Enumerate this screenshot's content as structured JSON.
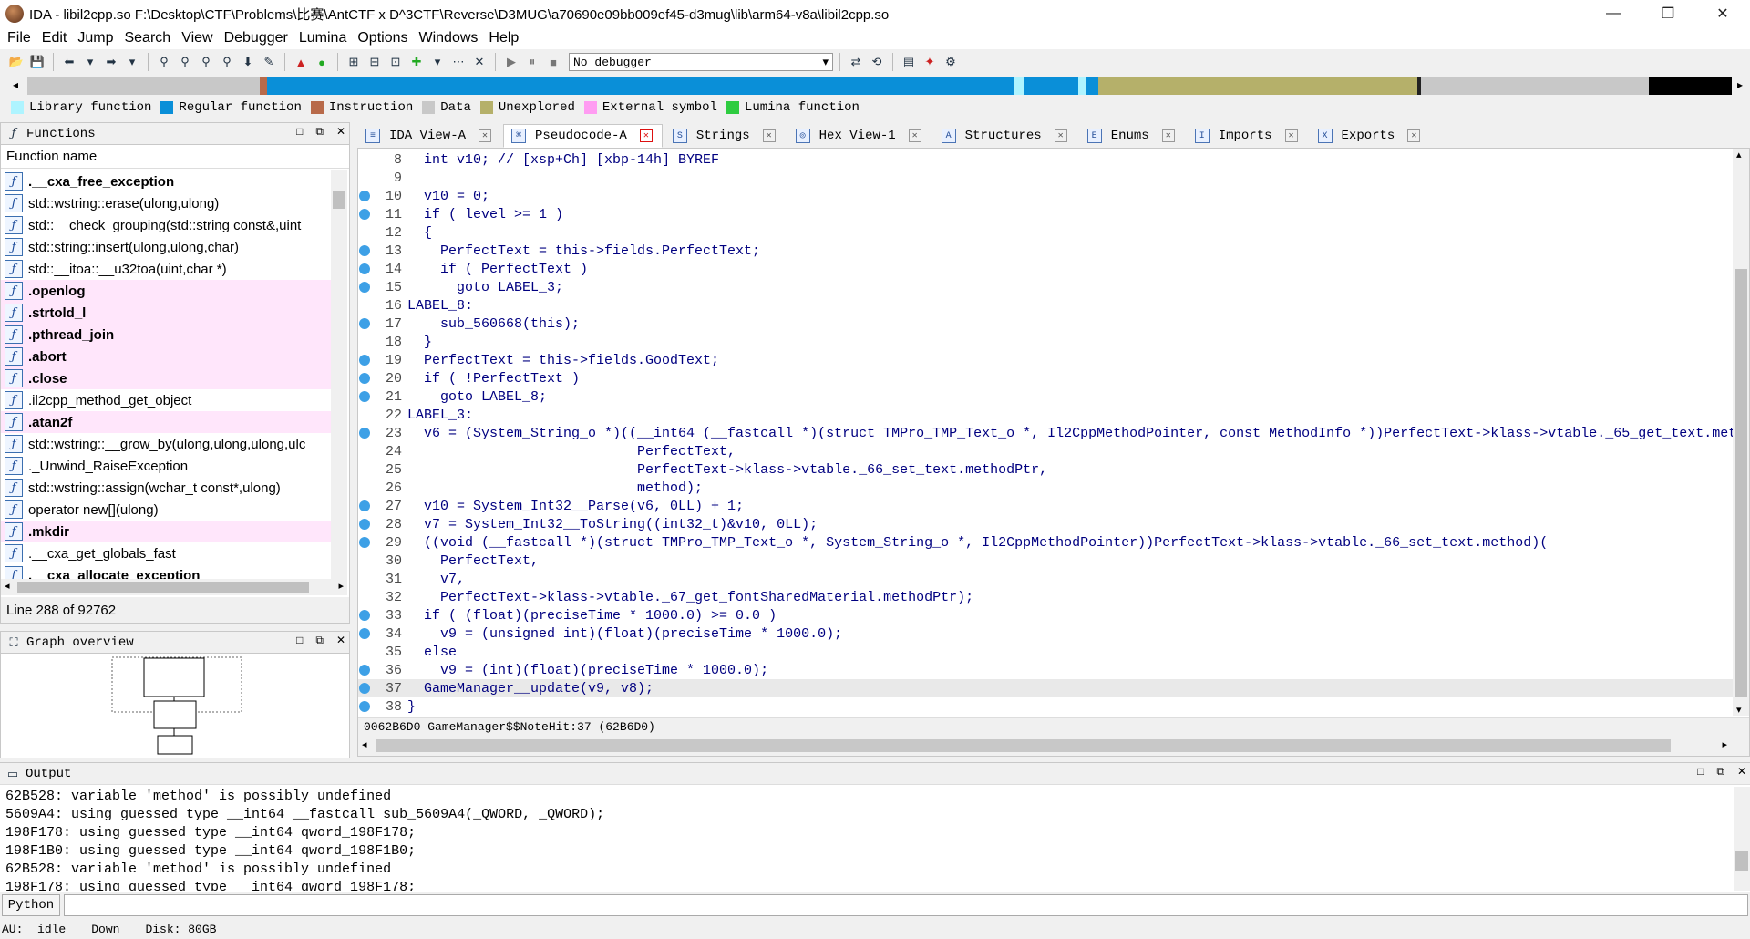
{
  "window": {
    "title": "IDA - libil2cpp.so F:\\Desktop\\CTF\\Problems\\比赛\\AntCTF x D^3CTF\\Reverse\\D3MUG\\a70690e09bb009ef45-d3mug\\lib\\arm64-v8a\\libil2cpp.so",
    "minimize": "—",
    "maximize": "❐",
    "close": "✕"
  },
  "menu": [
    "File",
    "Edit",
    "Jump",
    "Search",
    "View",
    "Debugger",
    "Lumina",
    "Options",
    "Windows",
    "Help"
  ],
  "toolbar": {
    "debugger_select": "No debugger"
  },
  "legend": [
    {
      "label": "Library function",
      "color": "#aef4ff"
    },
    {
      "label": "Regular function",
      "color": "#0a8fd8"
    },
    {
      "label": "Instruction",
      "color": "#b86a4a"
    },
    {
      "label": "Data",
      "color": "#c8c8c8"
    },
    {
      "label": "Unexplored",
      "color": "#b5b06a"
    },
    {
      "label": "External symbol",
      "color": "#ff9cf2"
    },
    {
      "label": "Lumina function",
      "color": "#2ecc40"
    }
  ],
  "functions_panel": {
    "title": "Functions",
    "column_header": "Function name",
    "status": "Line 288 of 92762",
    "items": [
      {
        "name": ".__cxa_free_exception",
        "bold": true,
        "lib": false
      },
      {
        "name": "std::wstring::erase(ulong,ulong)",
        "bold": false,
        "lib": false
      },
      {
        "name": "std::__check_grouping(std::string const&,uint",
        "bold": false,
        "lib": false
      },
      {
        "name": "std::string::insert(ulong,ulong,char)",
        "bold": false,
        "lib": false
      },
      {
        "name": "std::__itoa::__u32toa(uint,char *)",
        "bold": false,
        "lib": false
      },
      {
        "name": ".openlog",
        "bold": true,
        "lib": true
      },
      {
        "name": ".strtold_l",
        "bold": true,
        "lib": true
      },
      {
        "name": ".pthread_join",
        "bold": true,
        "lib": true
      },
      {
        "name": ".abort",
        "bold": true,
        "lib": true
      },
      {
        "name": ".close",
        "bold": true,
        "lib": true
      },
      {
        "name": ".il2cpp_method_get_object",
        "bold": false,
        "lib": false
      },
      {
        "name": ".atan2f",
        "bold": true,
        "lib": true
      },
      {
        "name": "std::wstring::__grow_by(ulong,ulong,ulong,ulc",
        "bold": false,
        "lib": false
      },
      {
        "name": "._Unwind_RaiseException",
        "bold": false,
        "lib": false
      },
      {
        "name": "std::wstring::assign(wchar_t const*,ulong)",
        "bold": false,
        "lib": false
      },
      {
        "name": "operator new[](ulong)",
        "bold": false,
        "lib": false
      },
      {
        "name": ".mkdir",
        "bold": true,
        "lib": true
      },
      {
        "name": ".__cxa_get_globals_fast",
        "bold": false,
        "lib": false
      },
      {
        "name": ".__cxa_allocate_exception",
        "bold": true,
        "lib": false
      }
    ]
  },
  "graph_panel": {
    "title": "Graph overview"
  },
  "tabs": [
    {
      "label": "IDA View-A",
      "icon": "idaview-icon",
      "active": false
    },
    {
      "label": "Pseudocode-A",
      "icon": "pseudocode-icon",
      "active": true
    },
    {
      "label": "Strings",
      "icon": "strings-icon",
      "active": false
    },
    {
      "label": "Hex View-1",
      "icon": "hexview-icon",
      "active": false
    },
    {
      "label": "Structures",
      "icon": "structures-icon",
      "active": false
    },
    {
      "label": "Enums",
      "icon": "enums-icon",
      "active": false
    },
    {
      "label": "Imports",
      "icon": "imports-icon",
      "active": false
    },
    {
      "label": "Exports",
      "icon": "exports-icon",
      "active": false
    }
  ],
  "code": {
    "lines": [
      {
        "n": "8",
        "bp": false,
        "text": "  int v10; // [xsp+Ch] [xbp-14h] BYREF"
      },
      {
        "n": "9",
        "bp": false,
        "text": ""
      },
      {
        "n": "10",
        "bp": true,
        "text": "  v10 = 0;"
      },
      {
        "n": "11",
        "bp": true,
        "text": "  if ( level >= 1 )"
      },
      {
        "n": "12",
        "bp": false,
        "text": "  {"
      },
      {
        "n": "13",
        "bp": true,
        "text": "    PerfectText = this->fields.PerfectText;"
      },
      {
        "n": "14",
        "bp": true,
        "text": "    if ( PerfectText )"
      },
      {
        "n": "15",
        "bp": true,
        "text": "      goto LABEL_3;"
      },
      {
        "n": "16",
        "bp": false,
        "text": "LABEL_8:"
      },
      {
        "n": "17",
        "bp": true,
        "text": "    sub_560668(this);"
      },
      {
        "n": "18",
        "bp": false,
        "text": "  }"
      },
      {
        "n": "19",
        "bp": true,
        "text": "  PerfectText = this->fields.GoodText;"
      },
      {
        "n": "20",
        "bp": true,
        "text": "  if ( !PerfectText )"
      },
      {
        "n": "21",
        "bp": true,
        "text": "    goto LABEL_8;"
      },
      {
        "n": "22",
        "bp": false,
        "text": "LABEL_3:"
      },
      {
        "n": "23",
        "bp": true,
        "text": "  v6 = (System_String_o *)((__int64 (__fastcall *)(struct TMPro_TMP_Text_o *, Il2CppMethodPointer, const MethodInfo *))PerfectText->klass->vtable._65_get_text.meth"
      },
      {
        "n": "24",
        "bp": false,
        "text": "                            PerfectText,"
      },
      {
        "n": "25",
        "bp": false,
        "text": "                            PerfectText->klass->vtable._66_set_text.methodPtr,"
      },
      {
        "n": "26",
        "bp": false,
        "text": "                            method);"
      },
      {
        "n": "27",
        "bp": true,
        "text": "  v10 = System_Int32__Parse(v6, 0LL) + 1;"
      },
      {
        "n": "28",
        "bp": true,
        "text": "  v7 = System_Int32__ToString((int32_t)&v10, 0LL);"
      },
      {
        "n": "29",
        "bp": true,
        "text": "  ((void (__fastcall *)(struct TMPro_TMP_Text_o *, System_String_o *, Il2CppMethodPointer))PerfectText->klass->vtable._66_set_text.method)("
      },
      {
        "n": "30",
        "bp": false,
        "text": "    PerfectText,"
      },
      {
        "n": "31",
        "bp": false,
        "text": "    v7,"
      },
      {
        "n": "32",
        "bp": false,
        "text": "    PerfectText->klass->vtable._67_get_fontSharedMaterial.methodPtr);"
      },
      {
        "n": "33",
        "bp": true,
        "text": "  if ( (float)(preciseTime * 1000.0) >= 0.0 )"
      },
      {
        "n": "34",
        "bp": true,
        "text": "    v9 = (unsigned int)(float)(preciseTime * 1000.0);"
      },
      {
        "n": "35",
        "bp": false,
        "text": "  else"
      },
      {
        "n": "36",
        "bp": true,
        "text": "    v9 = (int)(float)(preciseTime * 1000.0);"
      },
      {
        "n": "37",
        "bp": true,
        "text": "  GameManager__update(v9, v8);",
        "highlight": true
      },
      {
        "n": "38",
        "bp": true,
        "text": "}"
      }
    ],
    "status": "0062B6D0 GameManager$$NoteHit:37 (62B6D0)"
  },
  "output": {
    "title": "Output",
    "lines": [
      "62B528: variable 'method' is possibly undefined",
      "5609A4: using guessed type __int64 __fastcall sub_5609A4(_QWORD, _QWORD);",
      "198F178: using guessed type __int64 qword_198F178;",
      "198F1B0: using guessed type __int64 qword_198F1B0;",
      "62B528: variable 'method' is possibly undefined",
      "198F178: using guessed type __int64 qword_198F178;"
    ]
  },
  "python": {
    "label": "Python"
  },
  "statusbar": {
    "au": "AU:",
    "state": "idle",
    "direction": "Down",
    "disk": "Disk: 80GB"
  }
}
